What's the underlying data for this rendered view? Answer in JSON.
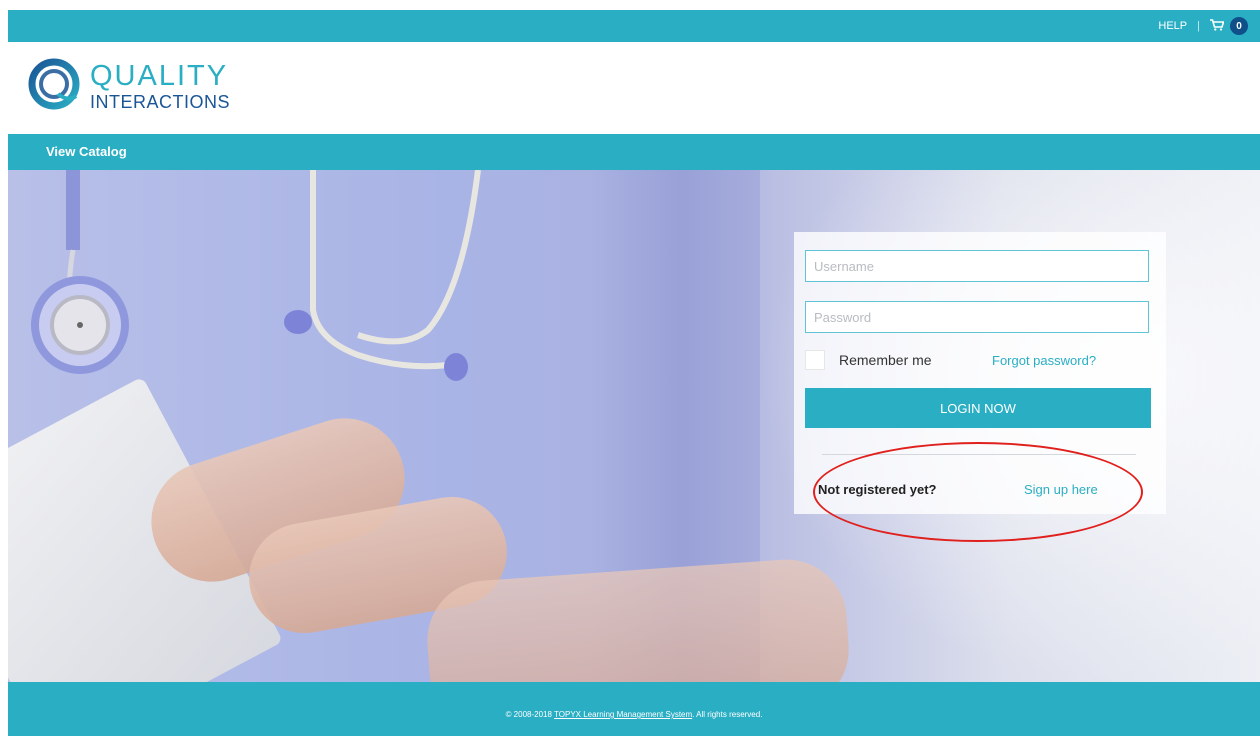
{
  "header": {
    "help_label": "HELP",
    "separator": "|",
    "cart_count": "0",
    "accent_color": "#2aaec4"
  },
  "logo": {
    "line1": "QUALITY",
    "line2": "INTERACTIONS"
  },
  "nav": {
    "view_catalog": "View Catalog"
  },
  "login": {
    "username_placeholder": "Username",
    "password_placeholder": "Password",
    "remember_label": "Remember me",
    "forgot_label": "Forgot password?",
    "login_button": "LOGIN NOW",
    "not_registered": "Not registered yet?",
    "signup_link": "Sign up here"
  },
  "footer": {
    "copyright_prefix": "© 2008-2018",
    "lms_link": "TOPYX Learning Management System",
    "copyright_suffix": ". All rights reserved."
  },
  "icons": {
    "cart": "cart-icon",
    "logo_mark": "logo-swirl-icon",
    "stethoscope": "stethoscope-illustration"
  }
}
